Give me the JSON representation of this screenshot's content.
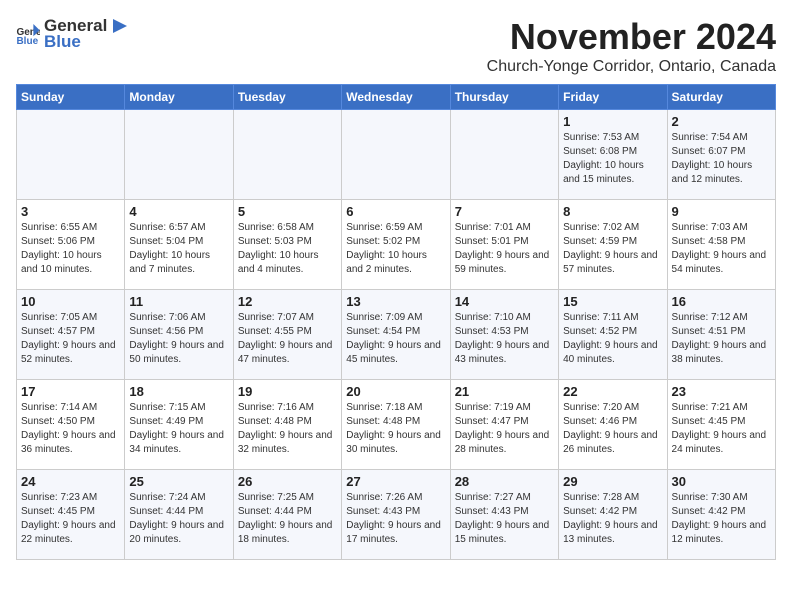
{
  "header": {
    "logo_general": "General",
    "logo_blue": "Blue",
    "month": "November 2024",
    "location": "Church-Yonge Corridor, Ontario, Canada"
  },
  "days_of_week": [
    "Sunday",
    "Monday",
    "Tuesday",
    "Wednesday",
    "Thursday",
    "Friday",
    "Saturday"
  ],
  "weeks": [
    [
      {
        "day": "",
        "content": ""
      },
      {
        "day": "",
        "content": ""
      },
      {
        "day": "",
        "content": ""
      },
      {
        "day": "",
        "content": ""
      },
      {
        "day": "",
        "content": ""
      },
      {
        "day": "1",
        "content": "Sunrise: 7:53 AM\nSunset: 6:08 PM\nDaylight: 10 hours and 15 minutes."
      },
      {
        "day": "2",
        "content": "Sunrise: 7:54 AM\nSunset: 6:07 PM\nDaylight: 10 hours and 12 minutes."
      }
    ],
    [
      {
        "day": "3",
        "content": "Sunrise: 6:55 AM\nSunset: 5:06 PM\nDaylight: 10 hours and 10 minutes."
      },
      {
        "day": "4",
        "content": "Sunrise: 6:57 AM\nSunset: 5:04 PM\nDaylight: 10 hours and 7 minutes."
      },
      {
        "day": "5",
        "content": "Sunrise: 6:58 AM\nSunset: 5:03 PM\nDaylight: 10 hours and 4 minutes."
      },
      {
        "day": "6",
        "content": "Sunrise: 6:59 AM\nSunset: 5:02 PM\nDaylight: 10 hours and 2 minutes."
      },
      {
        "day": "7",
        "content": "Sunrise: 7:01 AM\nSunset: 5:01 PM\nDaylight: 9 hours and 59 minutes."
      },
      {
        "day": "8",
        "content": "Sunrise: 7:02 AM\nSunset: 4:59 PM\nDaylight: 9 hours and 57 minutes."
      },
      {
        "day": "9",
        "content": "Sunrise: 7:03 AM\nSunset: 4:58 PM\nDaylight: 9 hours and 54 minutes."
      }
    ],
    [
      {
        "day": "10",
        "content": "Sunrise: 7:05 AM\nSunset: 4:57 PM\nDaylight: 9 hours and 52 minutes."
      },
      {
        "day": "11",
        "content": "Sunrise: 7:06 AM\nSunset: 4:56 PM\nDaylight: 9 hours and 50 minutes."
      },
      {
        "day": "12",
        "content": "Sunrise: 7:07 AM\nSunset: 4:55 PM\nDaylight: 9 hours and 47 minutes."
      },
      {
        "day": "13",
        "content": "Sunrise: 7:09 AM\nSunset: 4:54 PM\nDaylight: 9 hours and 45 minutes."
      },
      {
        "day": "14",
        "content": "Sunrise: 7:10 AM\nSunset: 4:53 PM\nDaylight: 9 hours and 43 minutes."
      },
      {
        "day": "15",
        "content": "Sunrise: 7:11 AM\nSunset: 4:52 PM\nDaylight: 9 hours and 40 minutes."
      },
      {
        "day": "16",
        "content": "Sunrise: 7:12 AM\nSunset: 4:51 PM\nDaylight: 9 hours and 38 minutes."
      }
    ],
    [
      {
        "day": "17",
        "content": "Sunrise: 7:14 AM\nSunset: 4:50 PM\nDaylight: 9 hours and 36 minutes."
      },
      {
        "day": "18",
        "content": "Sunrise: 7:15 AM\nSunset: 4:49 PM\nDaylight: 9 hours and 34 minutes."
      },
      {
        "day": "19",
        "content": "Sunrise: 7:16 AM\nSunset: 4:48 PM\nDaylight: 9 hours and 32 minutes."
      },
      {
        "day": "20",
        "content": "Sunrise: 7:18 AM\nSunset: 4:48 PM\nDaylight: 9 hours and 30 minutes."
      },
      {
        "day": "21",
        "content": "Sunrise: 7:19 AM\nSunset: 4:47 PM\nDaylight: 9 hours and 28 minutes."
      },
      {
        "day": "22",
        "content": "Sunrise: 7:20 AM\nSunset: 4:46 PM\nDaylight: 9 hours and 26 minutes."
      },
      {
        "day": "23",
        "content": "Sunrise: 7:21 AM\nSunset: 4:45 PM\nDaylight: 9 hours and 24 minutes."
      }
    ],
    [
      {
        "day": "24",
        "content": "Sunrise: 7:23 AM\nSunset: 4:45 PM\nDaylight: 9 hours and 22 minutes."
      },
      {
        "day": "25",
        "content": "Sunrise: 7:24 AM\nSunset: 4:44 PM\nDaylight: 9 hours and 20 minutes."
      },
      {
        "day": "26",
        "content": "Sunrise: 7:25 AM\nSunset: 4:44 PM\nDaylight: 9 hours and 18 minutes."
      },
      {
        "day": "27",
        "content": "Sunrise: 7:26 AM\nSunset: 4:43 PM\nDaylight: 9 hours and 17 minutes."
      },
      {
        "day": "28",
        "content": "Sunrise: 7:27 AM\nSunset: 4:43 PM\nDaylight: 9 hours and 15 minutes."
      },
      {
        "day": "29",
        "content": "Sunrise: 7:28 AM\nSunset: 4:42 PM\nDaylight: 9 hours and 13 minutes."
      },
      {
        "day": "30",
        "content": "Sunrise: 7:30 AM\nSunset: 4:42 PM\nDaylight: 9 hours and 12 minutes."
      }
    ]
  ]
}
